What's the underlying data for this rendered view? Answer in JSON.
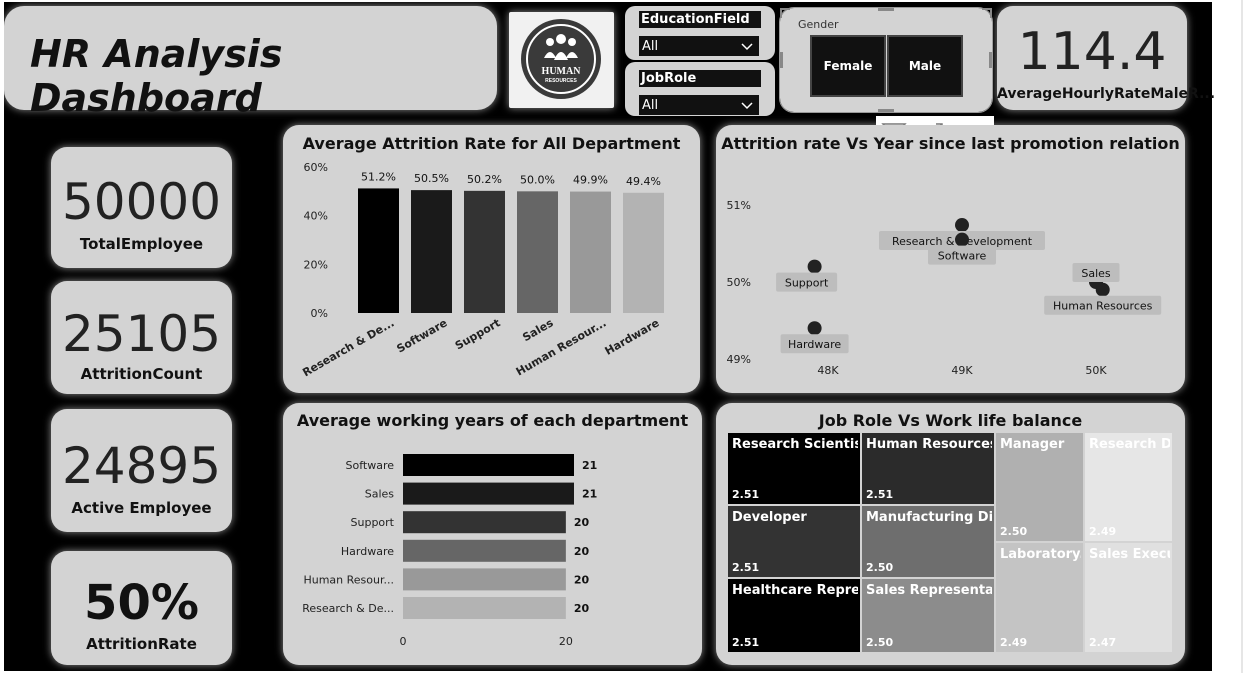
{
  "title": "HR Analysis Dashboard",
  "logo": {
    "line1": "HUMAN",
    "line2": "RESOURCES"
  },
  "slicers": {
    "education": {
      "label": "EducationField",
      "value": "All"
    },
    "jobrole": {
      "label": "JobRole",
      "value": "All"
    },
    "gender": {
      "label": "Gender",
      "options": [
        "Female",
        "Male"
      ]
    }
  },
  "avg_hourly": {
    "value": "114.4",
    "label": "AverageHourlyRateMaleR..."
  },
  "kpis": {
    "total": {
      "value": "50000",
      "label": "TotalEmployee"
    },
    "attrition_count": {
      "value": "25105",
      "label": "AttritionCount"
    },
    "active": {
      "value": "24895",
      "label": "Active Employee"
    },
    "rate": {
      "value": "50%",
      "label": "AttritionRate"
    }
  },
  "chart_data": [
    {
      "type": "bar",
      "title": "Average Attrition Rate for All Department",
      "categories": [
        "Research & De...",
        "Software",
        "Support",
        "Sales",
        "Human Resour...",
        "Hardware"
      ],
      "values": [
        51.2,
        50.5,
        50.2,
        50.0,
        49.9,
        49.4
      ],
      "value_labels": [
        "51.2%",
        "50.5%",
        "50.2%",
        "50.0%",
        "49.9%",
        "49.4%"
      ],
      "colors": [
        "#000000",
        "#1a1a1a",
        "#333333",
        "#666666",
        "#999999",
        "#b3b3b3"
      ],
      "yticks": [
        "0%",
        "20%",
        "40%",
        "60%"
      ],
      "ylim": [
        0,
        60
      ]
    },
    {
      "type": "scatter",
      "title": "Attrition rate Vs Year since last promotion relation",
      "points": [
        {
          "label": "Research & Development",
          "x": 49.0,
          "y": 50.74
        },
        {
          "label": "Software",
          "x": 49.0,
          "y": 50.55
        },
        {
          "label": "Support",
          "x": 47.9,
          "y": 50.2
        },
        {
          "label": "Sales",
          "x": 50.0,
          "y": 50.0
        },
        {
          "label": "Human Resources",
          "x": 50.05,
          "y": 49.9
        },
        {
          "label": "Hardware",
          "x": 47.9,
          "y": 49.4
        }
      ],
      "xticks": [
        "48K",
        "49K",
        "50K"
      ],
      "yticks": [
        "49%",
        "50%",
        "51%"
      ]
    },
    {
      "type": "bar",
      "orientation": "horizontal",
      "title": "Average working years of each department",
      "categories": [
        "Software",
        "Sales",
        "Support",
        "Hardware",
        "Human Resour...",
        "Research & De..."
      ],
      "values": [
        21,
        21,
        20,
        20,
        20,
        20
      ],
      "colors": [
        "#000000",
        "#1a1a1a",
        "#333333",
        "#666666",
        "#999999",
        "#b3b3b3"
      ],
      "xticks": [
        "0",
        "20"
      ],
      "xlim": [
        0,
        21
      ]
    },
    {
      "type": "heatmap",
      "title": "Job Role Vs Work life balance",
      "tiles": [
        {
          "name": "Research Scientist",
          "value": "2.51",
          "color": "#000000",
          "text": "#ffffff"
        },
        {
          "name": "Human Resources",
          "value": "2.51",
          "color": "#2b2b2b",
          "text": "#ffffff"
        },
        {
          "name": "Developer",
          "value": "2.51",
          "color": "#333333",
          "text": "#ffffff"
        },
        {
          "name": "Manufacturing Dir...",
          "value": "2.50",
          "color": "#6e6e6e",
          "text": "#ffffff"
        },
        {
          "name": "Healthcare Repres...",
          "value": "2.51",
          "color": "#000000",
          "text": "#ffffff"
        },
        {
          "name": "Sales Representative",
          "value": "2.50",
          "color": "#8c8c8c",
          "text": "#ffffff"
        },
        {
          "name": "Manager",
          "value": "2.50",
          "color": "#b0b0b0",
          "text": "#ffffff"
        },
        {
          "name": "Research D...",
          "value": "2.49",
          "color": "#e6e6e6",
          "text": "#ffffff"
        },
        {
          "name": "Laboratory...",
          "value": "2.49",
          "color": "#c4c4c4",
          "text": "#ffffff"
        },
        {
          "name": "Sales Execu...",
          "value": "2.47",
          "color": "#e0e0e0",
          "text": "#ffffff"
        }
      ]
    }
  ]
}
